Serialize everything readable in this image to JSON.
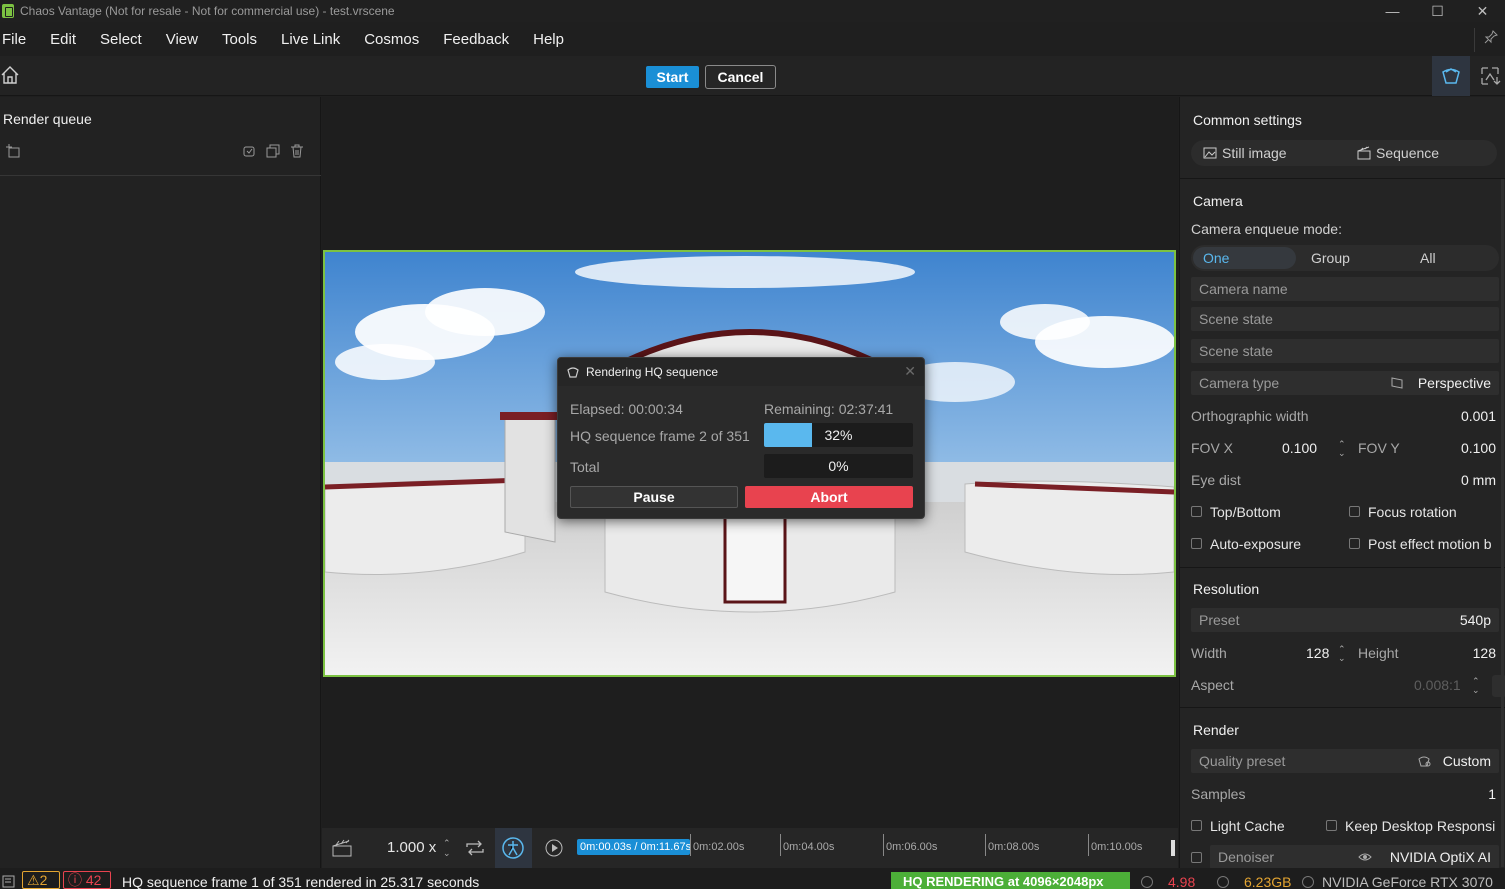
{
  "window": {
    "title": "Chaos Vantage (Not for resale - Not for commercial use) - test.vrscene",
    "controls": {
      "minimize": "—",
      "maximize": "☐",
      "close": "✕"
    }
  },
  "menu": [
    "File",
    "Edit",
    "Select",
    "View",
    "Tools",
    "Live Link",
    "Cosmos",
    "Feedback",
    "Help"
  ],
  "toolbar": {
    "start_label": "Start",
    "cancel_label": "Cancel"
  },
  "left_panel": {
    "title": "Render queue"
  },
  "dialog": {
    "title": "Rendering HQ sequence",
    "elapsed": "Elapsed: 00:00:34",
    "remaining": "Remaining: 02:37:41",
    "frame_label": "HQ sequence frame 2 of 351",
    "frame_progress_text": "32%",
    "frame_progress": 0.32,
    "total_label": "Total",
    "total_progress_text": "0%",
    "total_progress": 0.0,
    "pause_label": "Pause",
    "abort_label": "Abort"
  },
  "timeline": {
    "speed": "1.000 x",
    "current": "0m:00.03s / 0m:11.67s",
    "ticks": [
      "0m:02.00s",
      "0m:04.00s",
      "0m:06.00s",
      "0m:08.00s",
      "0m:10.00s"
    ]
  },
  "settings": {
    "common_title": "Common settings",
    "tab_still": "Still image",
    "tab_sequence": "Sequence",
    "camera": {
      "title": "Camera",
      "enqueue_label": "Camera enqueue mode:",
      "modes": [
        "One",
        "Group",
        "All"
      ],
      "active_mode": "One",
      "camera_name": "Camera name",
      "scene_state_1": "Scene state",
      "scene_state_2": "Scene state",
      "camera_type_label": "Camera type",
      "camera_type_value": "Perspective",
      "ortho_width_label": "Orthographic width",
      "ortho_width_value": "0.001",
      "fovx_label": "FOV X",
      "fovx_value": "0.100",
      "fovy_label": "FOV Y",
      "fovy_value": "0.100",
      "eye_dist_label": "Eye dist",
      "eye_dist_value": "0 mm",
      "top_bottom": "Top/Bottom",
      "focus_rotation": "Focus rotation",
      "auto_exposure": "Auto-exposure",
      "post_effect": "Post effect motion b"
    },
    "resolution": {
      "title": "Resolution",
      "preset_label": "Preset",
      "preset_value": "540p",
      "width_label": "Width",
      "width_value": "128",
      "height_label": "Height",
      "height_value": "128",
      "aspect_label": "Aspect",
      "aspect_value": "0.008:1"
    },
    "render": {
      "title": "Render",
      "quality_label": "Quality preset",
      "quality_value": "Custom",
      "samples_label": "Samples",
      "samples_value": "1",
      "light_cache": "Light Cache",
      "keep_desktop": "Keep Desktop Responsi",
      "denoiser_label": "Denoiser",
      "denoiser_value": "NVIDIA OptiX AI"
    }
  },
  "status": {
    "warnings": "2",
    "errors": "42",
    "message": "HQ sequence frame 1 of 351 rendered in 25.317 seconds",
    "hq_badge": "HQ RENDERING at 4096×2048px",
    "fps": "4.98",
    "memory": "6.23GB",
    "gpu": "NVIDIA GeForce RTX 3070"
  },
  "colors": {
    "accent_blue": "#1a8fd6",
    "abort_red": "#e8434f",
    "viewport_border_green": "#7cc242",
    "progress_blue": "#5ab8ee",
    "hq_green": "#4caf38"
  }
}
